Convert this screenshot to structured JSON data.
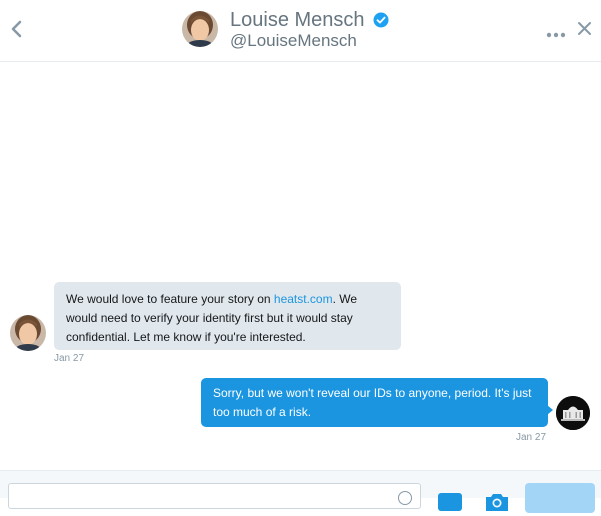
{
  "header": {
    "display_name": "Louise Mensch",
    "handle": "@LouiseMensch"
  },
  "messages": [
    {
      "direction": "incoming",
      "text_before_link": "We would love to feature your story on ",
      "link_text": "heatst.com",
      "text_after_link": ".  We would need to verify your identity first but it would stay confidential.  Let me know if you're interested.",
      "timestamp": "Jan 27"
    },
    {
      "direction": "outgoing",
      "text": "Sorry, but we won't reveal our IDs to anyone, period. It's just too much of a risk.",
      "timestamp": "Jan 27"
    }
  ],
  "composer": {
    "input_value": "",
    "placeholder": ""
  },
  "colors": {
    "accent": "#1b95e0",
    "incoming_bubble": "#e1e8ed",
    "send_button": "#a3d5f7",
    "verified": "#1da1f2"
  },
  "icons": [
    "chevron-left-icon",
    "verified-badge-icon",
    "more-dots-icon",
    "close-icon",
    "emoji-icon",
    "gif-icon",
    "camera-icon"
  ]
}
